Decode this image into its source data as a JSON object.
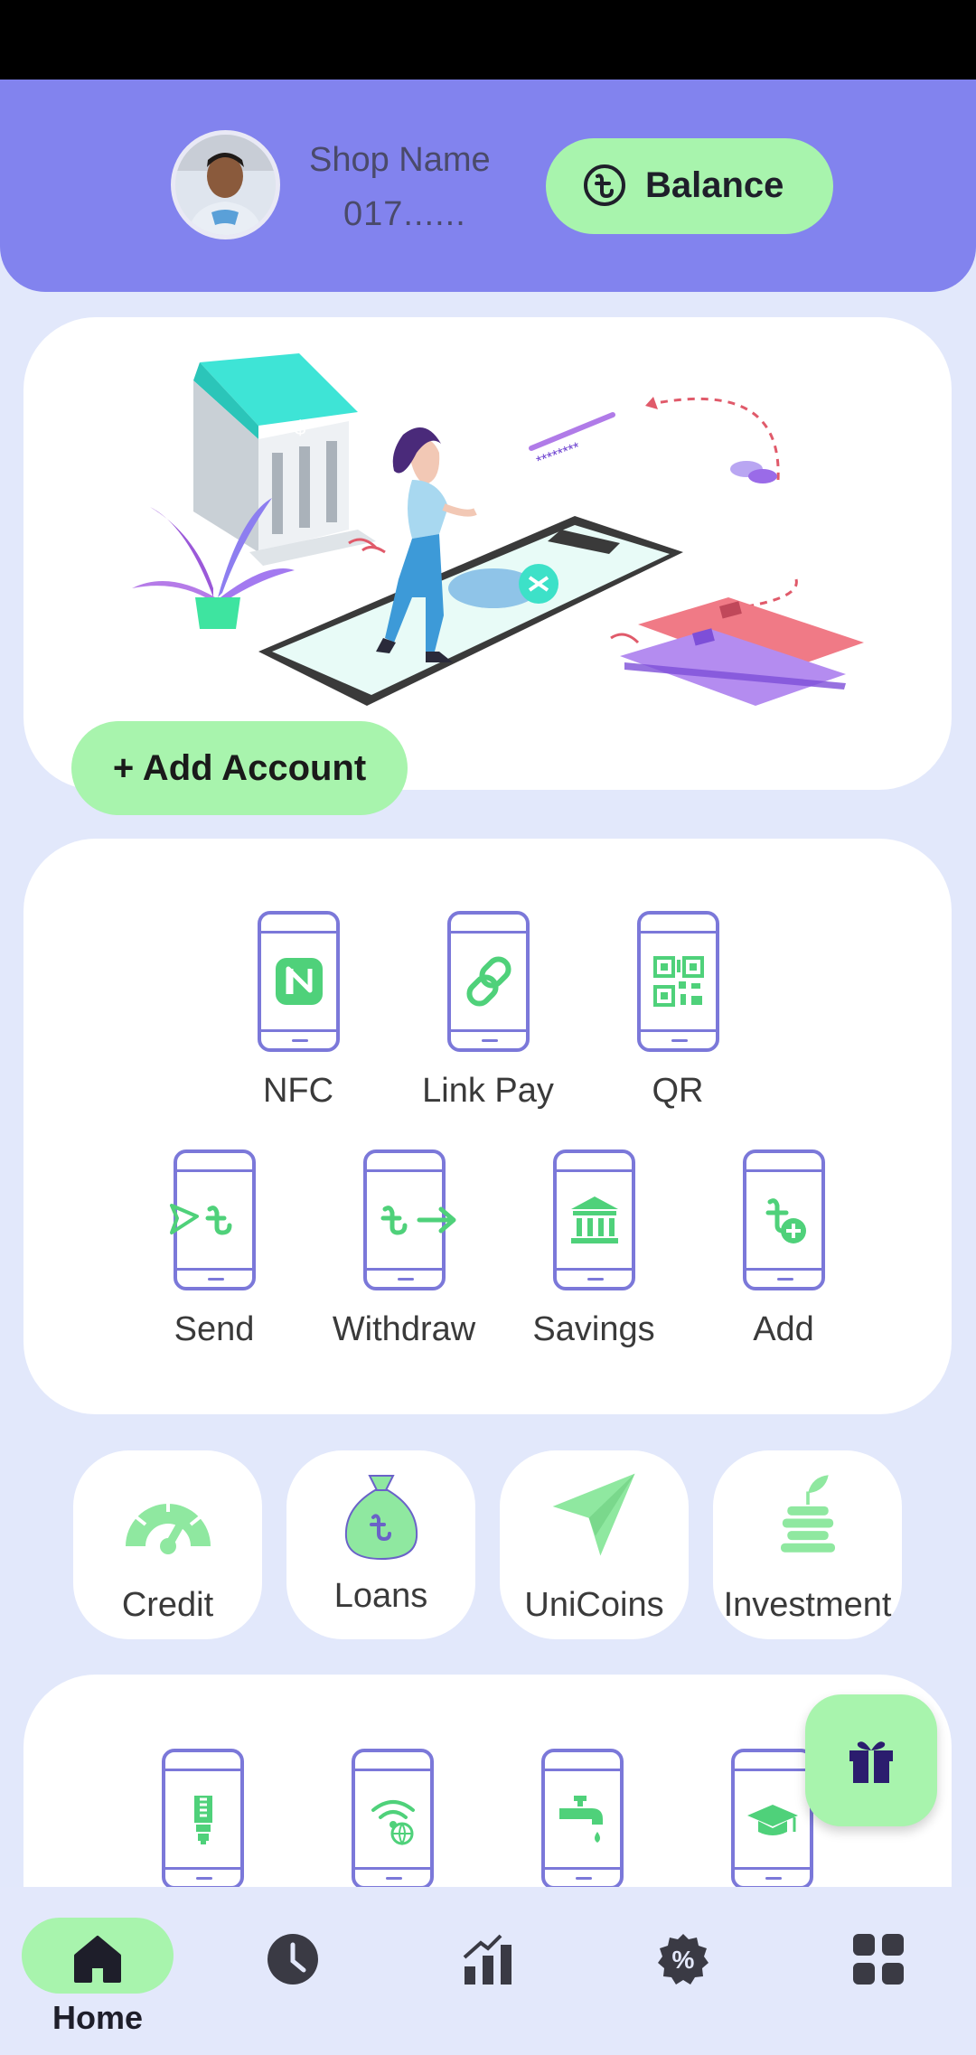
{
  "header": {
    "shop_name": "Shop Name",
    "phone": "017......",
    "balance_label": "Balance"
  },
  "hero": {
    "add_account_label": "+ Add Account",
    "illustration_caption": "********"
  },
  "actions": {
    "row1": [
      {
        "label": "NFC",
        "icon": "nfc-icon"
      },
      {
        "label": "Link Pay",
        "icon": "link-icon"
      },
      {
        "label": "QR",
        "icon": "qr-code-icon"
      }
    ],
    "row2": [
      {
        "label": "Send",
        "icon": "send-taka-icon"
      },
      {
        "label": "Withdraw",
        "icon": "withdraw-taka-icon"
      },
      {
        "label": "Savings",
        "icon": "bank-icon"
      },
      {
        "label": "Add",
        "icon": "add-taka-icon"
      }
    ]
  },
  "chips": [
    {
      "label": "Credit",
      "icon": "gauge-icon"
    },
    {
      "label": "Loans",
      "icon": "money-bag-icon"
    },
    {
      "label": "UniCoins",
      "icon": "paper-plane-icon"
    },
    {
      "label": "Investment",
      "icon": "plant-coins-icon"
    }
  ],
  "bills": [
    {
      "icon": "electricity-icon"
    },
    {
      "icon": "internet-icon"
    },
    {
      "icon": "water-tap-icon"
    },
    {
      "icon": "education-icon"
    }
  ],
  "nav": {
    "home_label": "Home",
    "items": [
      "home-icon",
      "history-icon",
      "stats-icon",
      "offers-icon",
      "menu-grid-icon"
    ]
  },
  "colors": {
    "accent_green": "#a8f4ad",
    "icon_green": "#4fd17a",
    "header_purple": "#8283ee",
    "outline_purple": "#7b78d9",
    "background": "#e2e8fb"
  }
}
